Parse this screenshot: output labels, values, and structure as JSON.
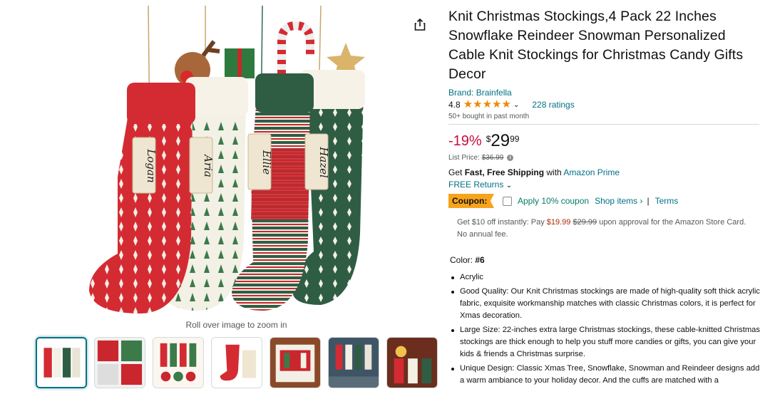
{
  "gallery": {
    "zoom_hint": "Roll over image to zoom in",
    "stocking_names": [
      "Logan",
      "Aria",
      "Ellie",
      "Hazel"
    ],
    "thumbnail_count": 7
  },
  "product": {
    "title": "Knit Christmas Stockings,4 Pack 22 Inches Snowflake Reindeer Snowman Personalized Cable Knit Stockings for Christmas Candy Gifts Decor",
    "brand": "Brand: Brainfella",
    "rating": "4.8",
    "ratings_count": "228 ratings",
    "bought": "50+ bought in past month"
  },
  "price": {
    "discount": "-19%",
    "symbol": "$",
    "whole": "29",
    "fraction": "99",
    "list_label": "List Price:",
    "list_value": "$36.99"
  },
  "shipping": {
    "get": "Get ",
    "fast_free": "Fast, Free Shipping",
    "with": " with ",
    "prime": "Amazon Prime",
    "returns": "FREE Returns"
  },
  "coupon": {
    "badge": "Coupon:",
    "apply": "Apply 10% coupon",
    "shop_items": "Shop items ›",
    "separator": "|",
    "terms": "Terms"
  },
  "card_offer": {
    "prefix": "Get $10 off instantly: Pay ",
    "new_price": "$19.99",
    "old_price": "$29.99",
    "suffix": " upon approval for the Amazon Store Card. No annual fee."
  },
  "color": {
    "label": "Color: ",
    "value": "#6"
  },
  "bullets": [
    "Acrylic",
    "Good Quality: Our Knit Christmas stockings are made of high-quality soft thick acrylic fabric, exquisite workmanship matches with classic Christmas colors, it is perfect for Xmas decoration.",
    "Large Size: 22-inches extra large Christmas stockings, these cable-knitted Christmas stockings are thick enough to help you stuff more candies or gifts, you can give your kids & friends a Christmas surprise.",
    "Unique Design: Classic Xmas Tree, Snowflake, Snowman and Reindeer designs add a warm ambiance to your holiday decor. And the cuffs are matched with a"
  ],
  "colors": {
    "link": "#007185",
    "deal_red": "#CC0C39",
    "star": "#F08804",
    "coupon_badge": "#F7A31C",
    "coupon_green": "#067D62"
  }
}
